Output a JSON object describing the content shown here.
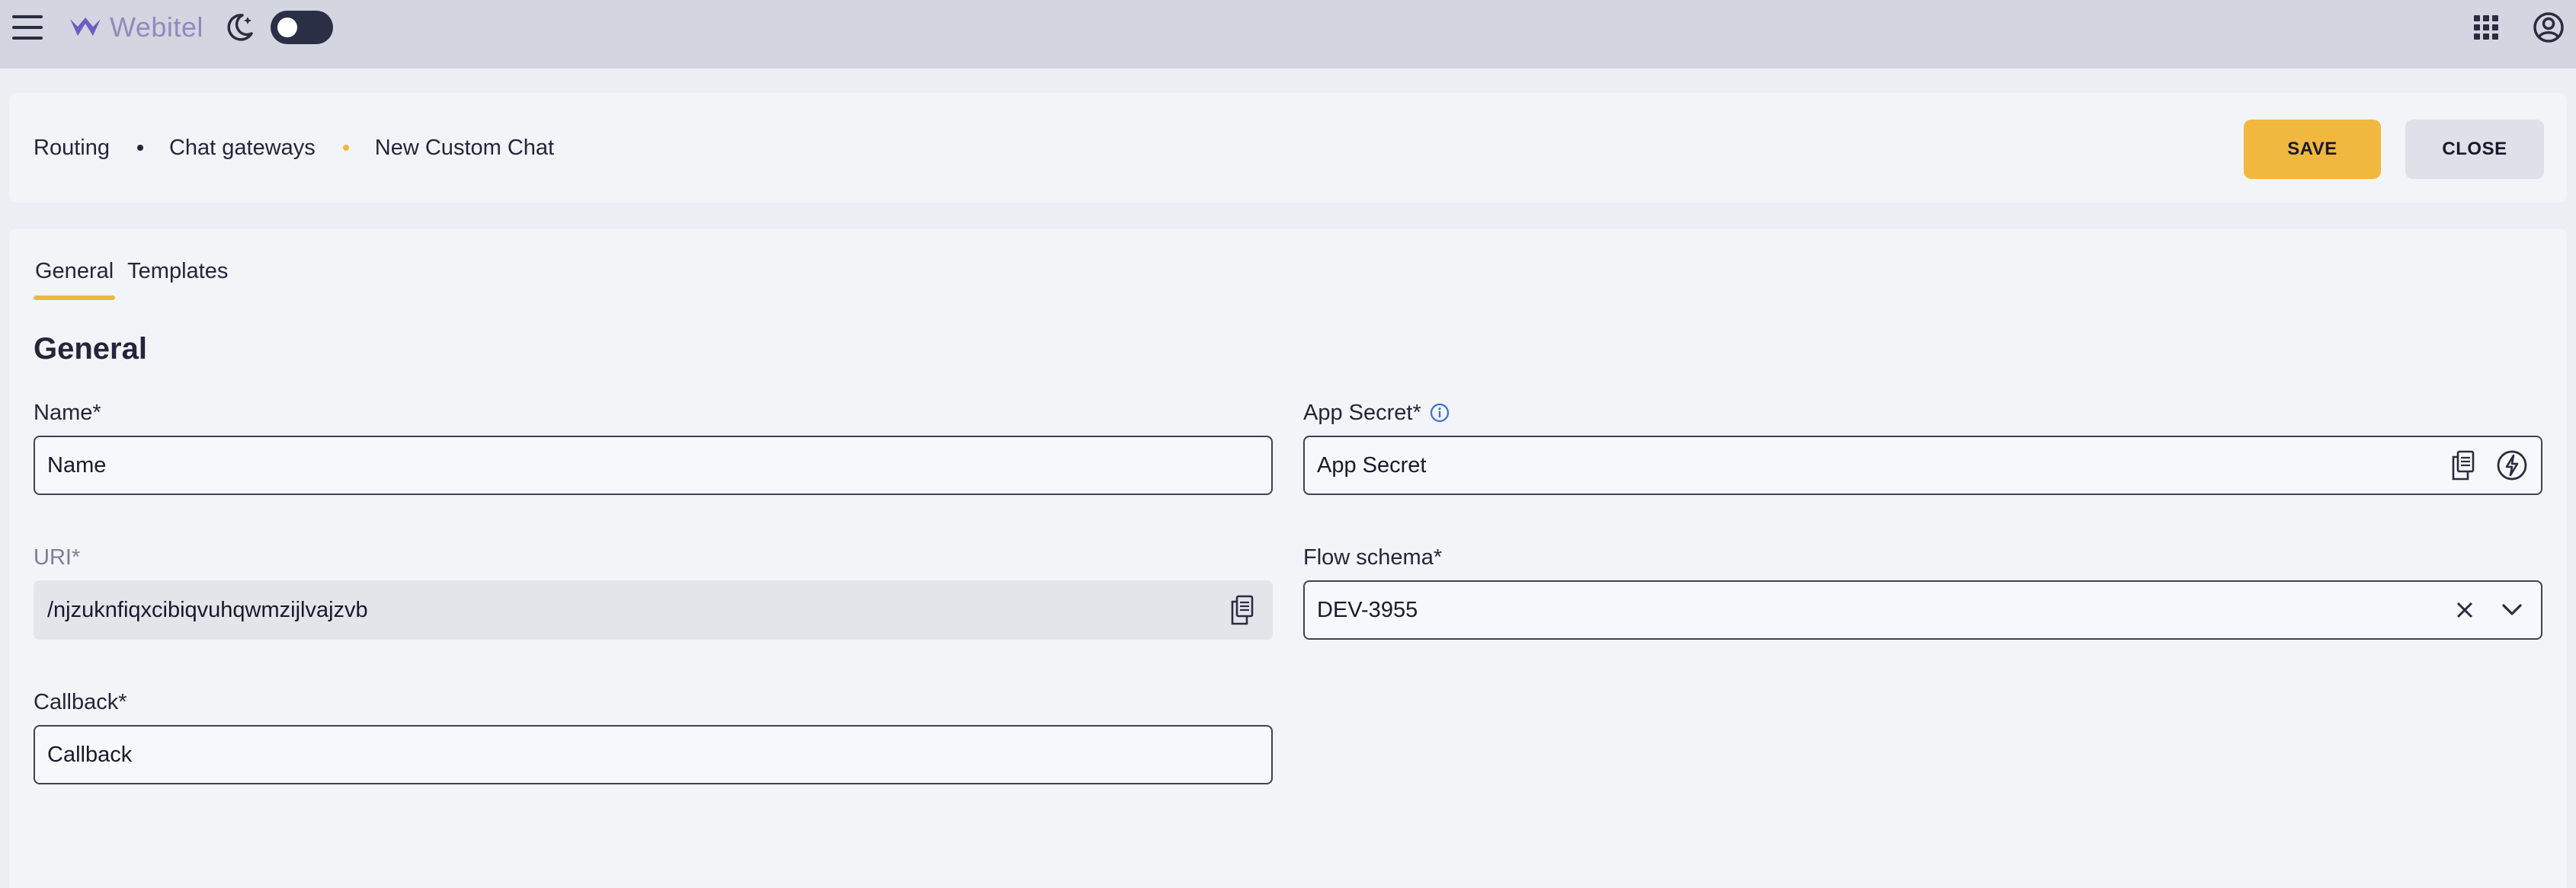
{
  "topbar": {
    "logo_text": "Webitel",
    "theme_toggle_state": "off"
  },
  "breadcrumb": {
    "items": [
      "Routing",
      "Chat gateways",
      "New Custom Chat"
    ]
  },
  "actions": {
    "save_label": "SAVE",
    "close_label": "CLOSE"
  },
  "tabs": [
    {
      "label": "General",
      "active": true
    },
    {
      "label": "Templates",
      "active": false
    }
  ],
  "section_title": "General",
  "form": {
    "name": {
      "label": "Name*",
      "placeholder": "Name",
      "value": ""
    },
    "uri": {
      "label": "URI*",
      "value": "/njzuknfiqxcibiqvuhqwmzijlvajzvb"
    },
    "callback": {
      "label": "Callback*",
      "placeholder": "Callback",
      "value": ""
    },
    "app_secret": {
      "label": "App Secret*",
      "placeholder": "App Secret",
      "value": ""
    },
    "flow_schema": {
      "label": "Flow schema*",
      "value": "DEV-3955"
    }
  },
  "colors": {
    "accent": "#f0b73f",
    "topbar_bg": "#d3d5e0",
    "page_bg": "#edeef3",
    "card_bg": "#f3f4f8",
    "info_icon": "#3b6fd6"
  }
}
